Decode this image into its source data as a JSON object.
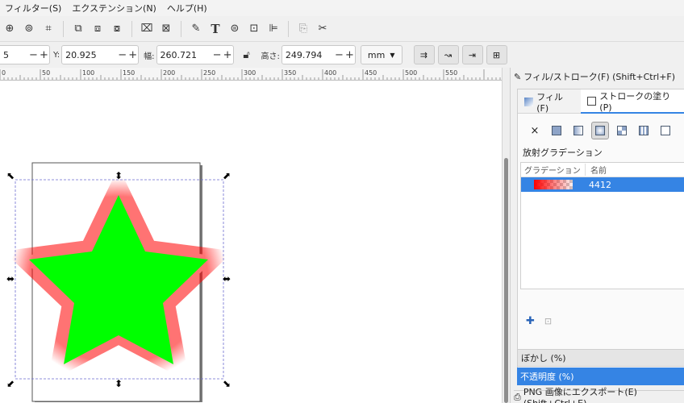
{
  "menubar": {
    "items": [
      "フィルター(S)",
      "エクステンション(N)",
      "ヘルプ(H)"
    ]
  },
  "commandbar": {
    "icons": [
      "zoom-drawing-icon",
      "zoom-page-icon",
      "zoom-selection-icon",
      "duplicate-icon",
      "clone-icon",
      "unlink-clone-icon",
      "group-icon",
      "ungroup-icon",
      "fill-stroke-icon",
      "text-font-icon",
      "layers-icon",
      "xml-editor-icon",
      "align-icon",
      "preferences-icon",
      "document-properties-icon"
    ]
  },
  "toolctrl": {
    "x_value": "5",
    "y_label": "Y:",
    "y_value": "20.925",
    "w_label": "幅:",
    "w_value": "260.721",
    "h_label": "高さ:",
    "h_value": "249.794",
    "unit": "mm",
    "lock_icon": "lock-icon"
  },
  "ruler": {
    "ticks": [
      "0",
      "50",
      "100",
      "150",
      "200",
      "250",
      "300",
      "350",
      "400",
      "450",
      "500",
      "550"
    ]
  },
  "dock": {
    "title": "フィル/ストローク(F) (Shift+Ctrl+F)",
    "tabs": [
      "フィル(F)",
      "ストロークの塗り(P)"
    ],
    "gradient_heading": "放射グラデーション",
    "table_headers": [
      "グラデーション",
      "名前"
    ],
    "gradient_rows": [
      {
        "name": "4412"
      }
    ],
    "blur_label": "ぼかし (%)",
    "opacity_label": "不透明度 (%)",
    "export_label": "PNG 画像にエクスポート(E) (Shift+Ctrl+E)",
    "colors": {
      "accent": "#3584e4",
      "star_fill": "#00ff00",
      "star_stroke_gradient": "#ff0000"
    }
  }
}
